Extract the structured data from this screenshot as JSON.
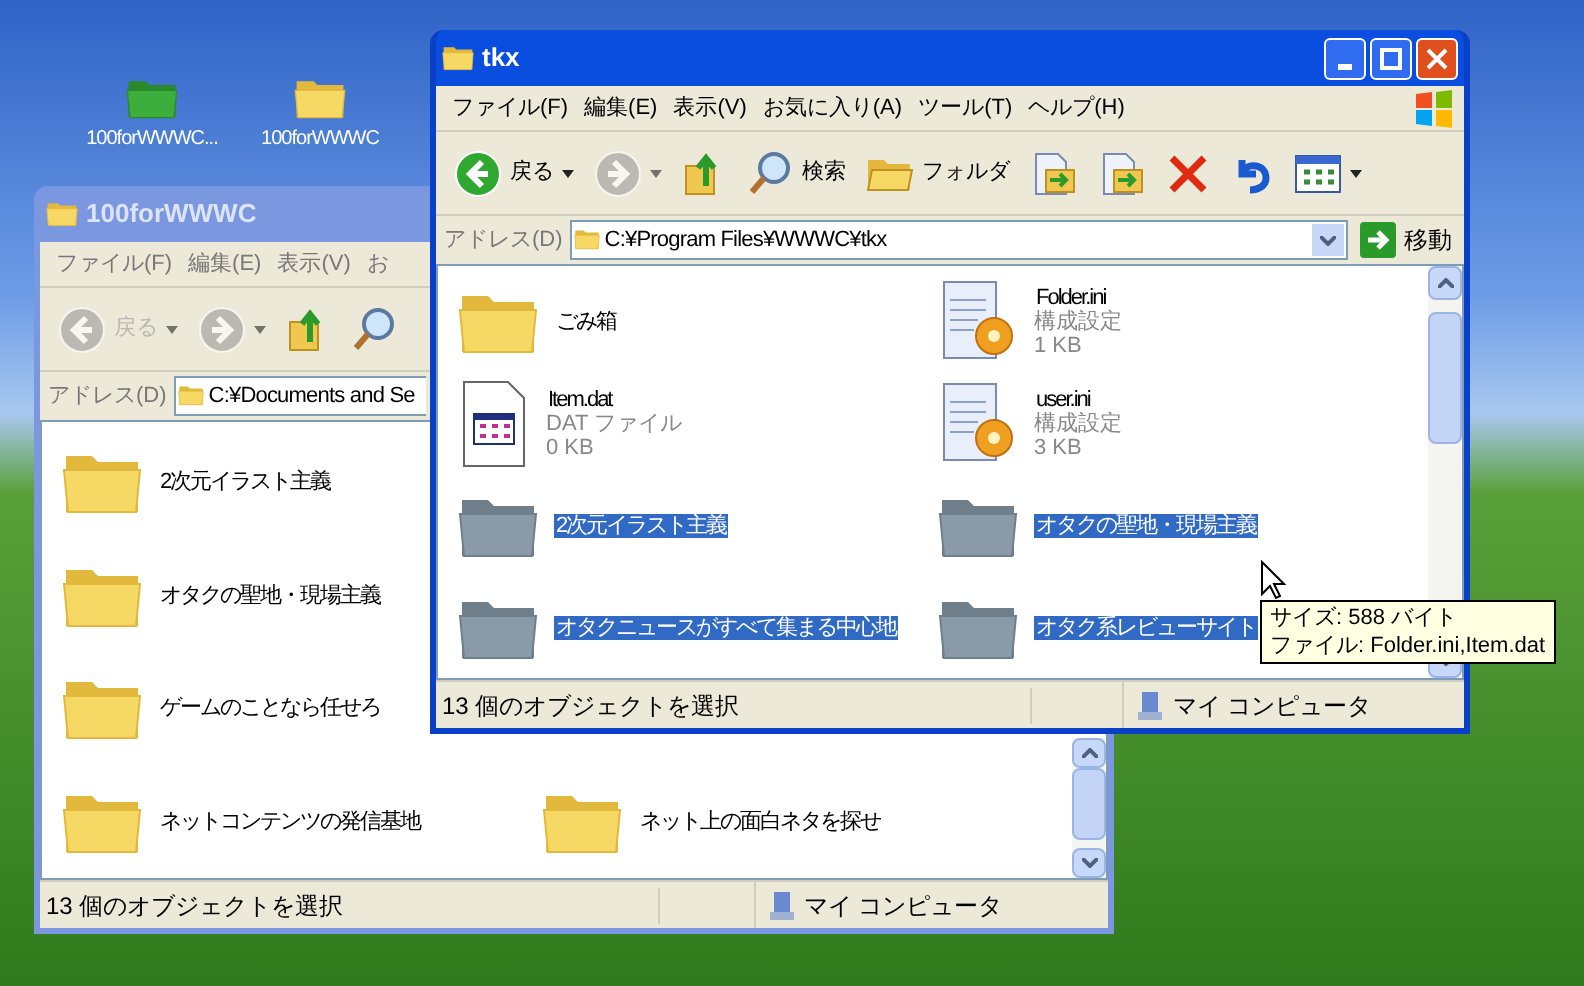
{
  "desktop_icons": [
    {
      "label": "100forWWWC...",
      "kind": "green"
    },
    {
      "label": "100forWWWC",
      "kind": "yellow"
    }
  ],
  "windows": [
    {
      "title": "100forWWWC",
      "active": false,
      "menu": [
        "ファイル(F)",
        "編集(E)",
        "表示(V)",
        "お"
      ],
      "toolbar": [
        {
          "kind": "back",
          "label": "戻る",
          "dropdown": true,
          "disabled": true
        },
        {
          "kind": "forward",
          "dropdown": true,
          "disabled": true
        },
        {
          "kind": "up",
          "disabled": false
        },
        {
          "kind": "search",
          "disabled": false
        }
      ],
      "address": {
        "label": "アドレス(D)",
        "value": "C:¥Documents and Se"
      },
      "rows": [
        [
          {
            "kind": "folder",
            "name": "2次元イラスト主義",
            "selected": false
          }
        ],
        [
          {
            "kind": "folder",
            "name": "オタクの聖地・現場主義",
            "selected": false
          }
        ],
        [
          {
            "kind": "folder",
            "name": "ゲームのことなら任せろ",
            "selected": false
          }
        ],
        [
          {
            "kind": "folder",
            "name": "ネットコンテンツの発信基地",
            "selected": false
          },
          {
            "kind": "folder",
            "name": "ネット上の面白ネタを探せ",
            "selected": false
          }
        ]
      ],
      "status": {
        "text": "13 個のオブジェクトを選択",
        "zone": "マイ コンピュータ"
      }
    },
    {
      "title": "tkx",
      "active": true,
      "menu": [
        "ファイル(F)",
        "編集(E)",
        "表示(V)",
        "お気に入り(A)",
        "ツール(T)",
        "ヘルプ(H)"
      ],
      "toolbar": [
        {
          "kind": "back",
          "label": "戻る",
          "dropdown": true,
          "disabled": false
        },
        {
          "kind": "forward",
          "dropdown": true,
          "disabled": true
        },
        {
          "kind": "up",
          "disabled": false
        },
        {
          "kind": "search",
          "label": "検索",
          "disabled": false
        },
        {
          "kind": "folders",
          "label": "フォルダ",
          "disabled": false
        },
        {
          "kind": "move",
          "disabled": false
        },
        {
          "kind": "copy",
          "disabled": false
        },
        {
          "kind": "delete",
          "disabled": false
        },
        {
          "kind": "undo",
          "disabled": false
        },
        {
          "kind": "views",
          "dropdown": true,
          "disabled": false
        }
      ],
      "address": {
        "label": "アドレス(D)",
        "value": "C:¥Program Files¥WWWC¥tkx",
        "go": "移動"
      },
      "rows": [
        [
          {
            "kind": "folder",
            "name": "ごみ箱",
            "selected": false
          },
          {
            "kind": "ini",
            "name": "Folder.ini",
            "type": "構成設定",
            "size": "1 KB",
            "selected": false
          }
        ],
        [
          {
            "kind": "dat",
            "name": "Item.dat",
            "type": "DAT ファイル",
            "size": "0 KB",
            "selected": false
          },
          {
            "kind": "ini",
            "name": "user.ini",
            "type": "構成設定",
            "size": "3 KB",
            "selected": false
          }
        ],
        [
          {
            "kind": "folder",
            "name": "2次元イラスト主義",
            "selected": true
          },
          {
            "kind": "folder",
            "name": "オタクの聖地・現場主義",
            "selected": true
          }
        ],
        [
          {
            "kind": "folder",
            "name": "オタクニュースがすべて集まる中心地",
            "selected": true
          },
          {
            "kind": "folder",
            "name": "オタク系レビューサイト",
            "selected": true
          }
        ]
      ],
      "status": {
        "text": "13 個のオブジェクトを選択",
        "zone": "マイ コンピュータ"
      }
    }
  ],
  "tooltip": [
    "サイズ: 588 バイト",
    "ファイル: Folder.ini,Item.dat"
  ]
}
